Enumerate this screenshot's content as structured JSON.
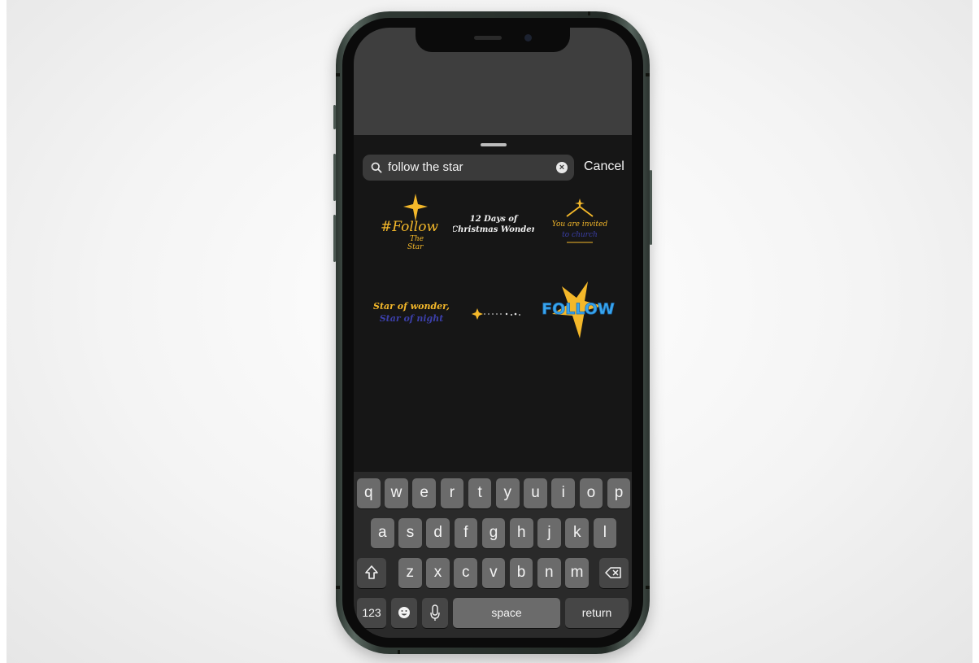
{
  "search": {
    "query": "follow the star",
    "cancel_label": "Cancel"
  },
  "stickers": [
    {
      "lines": [
        "#Follow",
        "The",
        "Star"
      ]
    },
    {
      "lines": [
        "12 Days of",
        "Christmas Wonder"
      ]
    },
    {
      "lines": [
        "You are invited",
        "to church"
      ]
    },
    {
      "lines": [
        "Star of wonder,",
        "Star of night"
      ]
    },
    {
      "lines": []
    },
    {
      "lines": [
        "FOLLOW"
      ]
    }
  ],
  "keyboard": {
    "row1": [
      "q",
      "w",
      "e",
      "r",
      "t",
      "y",
      "u",
      "i",
      "o",
      "p"
    ],
    "row2": [
      "a",
      "s",
      "d",
      "f",
      "g",
      "h",
      "j",
      "k",
      "l"
    ],
    "row3": [
      "z",
      "x",
      "c",
      "v",
      "b",
      "n",
      "m"
    ],
    "numbers_label": "123",
    "space_label": "space",
    "return_label": "return"
  },
  "colors": {
    "sheet_bg": "#161616",
    "key_bg": "#6b6b6b",
    "gold": "#f4b82a",
    "blue": "#3b3fa8",
    "sky_blue": "#39a6ee"
  }
}
